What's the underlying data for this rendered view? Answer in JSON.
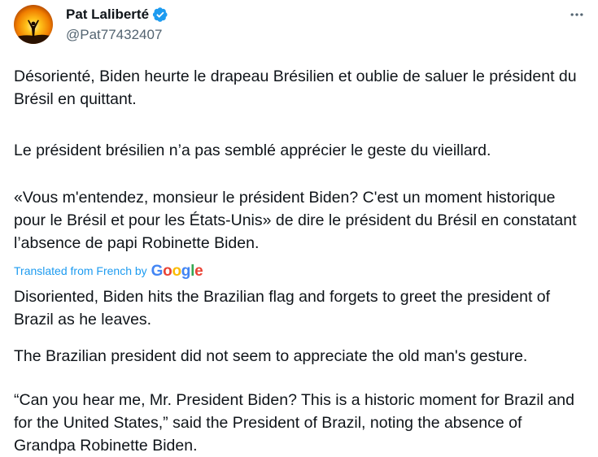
{
  "author": {
    "display_name": "Pat Laliberté",
    "handle": "@Pat77432407",
    "avatar_icon": "silhouette-sunset-avatar",
    "verified_icon": "verified-badge-icon"
  },
  "actions": {
    "more_icon": "more-dots-icon"
  },
  "original": {
    "para1": "Désorienté, Biden heurte le drapeau Brésilien et oublie de saluer le président du Brésil en quittant.",
    "para2": "Le président brésilien n’a pas semblé apprécier le geste du vieillard.",
    "para3": "«Vous m'entendez, monsieur le président Biden? C'est un moment historique pour le Brésil et pour les États-Unis» de dire le président du Brésil en constatant l’absence de papi Robinette Biden."
  },
  "translation": {
    "label": "Translated from French by",
    "provider": "Google",
    "para1": "Disoriented, Biden hits the Brazilian flag and forgets to greet the president of Brazil as he leaves.",
    "para2": "The Brazilian president did not seem to appreciate the old man's gesture.",
    "para3": "“Can you hear me, Mr. President Biden? This is a historic moment for Brazil and for the United States,” said the President of Brazil, noting the absence of Grandpa Robinette Biden."
  },
  "colors": {
    "link_blue": "#1d9bf0",
    "verified_blue": "#1d9bf0",
    "secondary_text": "#536471"
  }
}
